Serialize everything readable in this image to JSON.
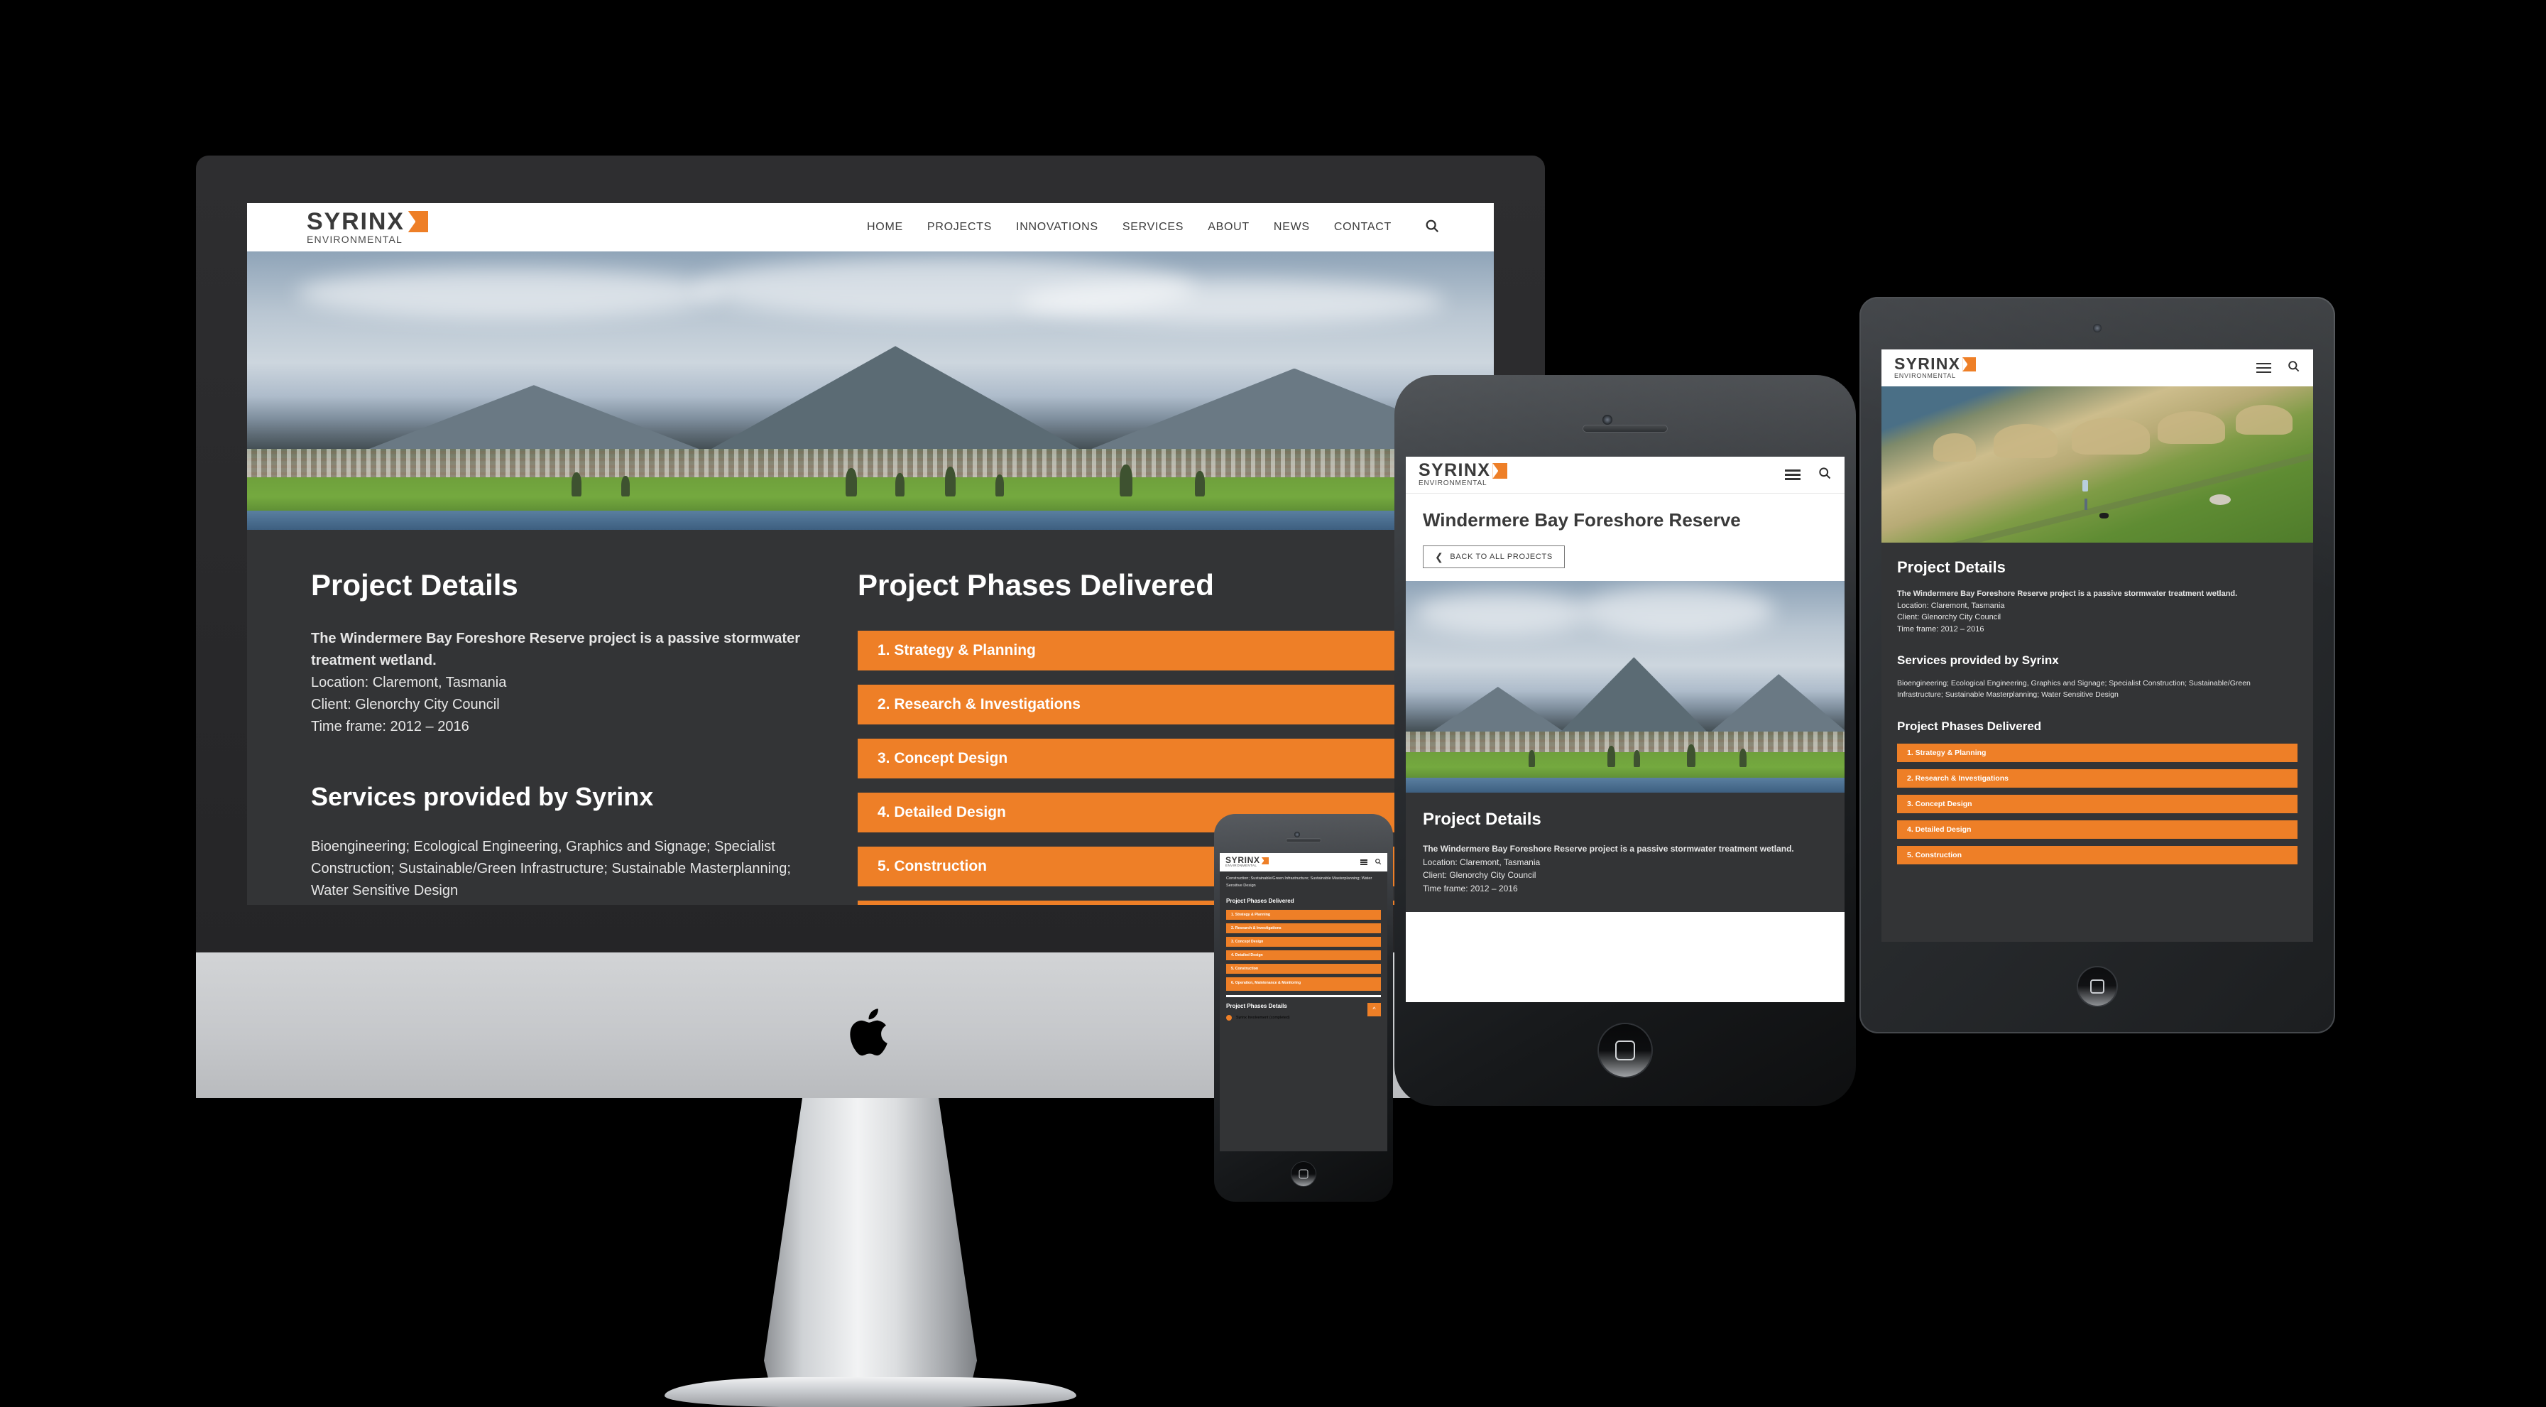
{
  "brand": {
    "name": "SYRINX",
    "subtitle": "ENVIRONMENTAL",
    "accent": "#ee7f27",
    "dark_bg": "#333436",
    "white": "#ffffff"
  },
  "nav": {
    "items": [
      {
        "label": "HOME"
      },
      {
        "label": "PROJECTS"
      },
      {
        "label": "INNOVATIONS"
      },
      {
        "label": "SERVICES"
      },
      {
        "label": "ABOUT"
      },
      {
        "label": "NEWS"
      },
      {
        "label": "CONTACT"
      }
    ],
    "search_icon": "search-icon",
    "menu_icon": "hamburger-icon"
  },
  "page": {
    "title": "Windermere Bay Foreshore Reserve",
    "back_button": "BACK TO ALL PROJECTS",
    "back_icon": "chevron-left-icon"
  },
  "project_details": {
    "heading": "Project Details",
    "lead": "The Windermere Bay Foreshore Reserve project is a passive stormwater treatment wetland.",
    "location": "Location: Claremont, Tasmania",
    "client": "Client: Glenorchy City Council",
    "timeframe": "Time frame: 2012 – 2016"
  },
  "services": {
    "heading": "Services provided by Syrinx",
    "text": "Bioengineering; Ecological Engineering, Graphics and Signage; Specialist Construction; Sustainable/Green Infrastructure; Sustainable Masterplanning; Water Sensitive Design",
    "text_tail": "Construction; Sustainable/Green Infrastructure; Sustainable Masterplanning; Water Sensitive Design"
  },
  "phases": {
    "heading": "Project Phases Delivered",
    "items": [
      {
        "label": "1. Strategy & Planning"
      },
      {
        "label": "2. Research & Investigations"
      },
      {
        "label": "3. Concept Design"
      },
      {
        "label": "4. Detailed Design"
      },
      {
        "label": "5. Construction"
      },
      {
        "label": "6. Operation, Maintenance & Monitoring"
      }
    ]
  },
  "phase_details": {
    "heading": "Project Phases Details",
    "legend": "Syrinx Involvement (completed)",
    "scroll_top_icon": "chevron-up-icon"
  },
  "devices": {
    "imac": {
      "name": "iMac",
      "logo": "apple-logo"
    },
    "ipad": {
      "name": "iPad"
    },
    "iphone": {
      "name": "iPhone"
    },
    "iphone_small": {
      "name": "iPhone"
    }
  }
}
